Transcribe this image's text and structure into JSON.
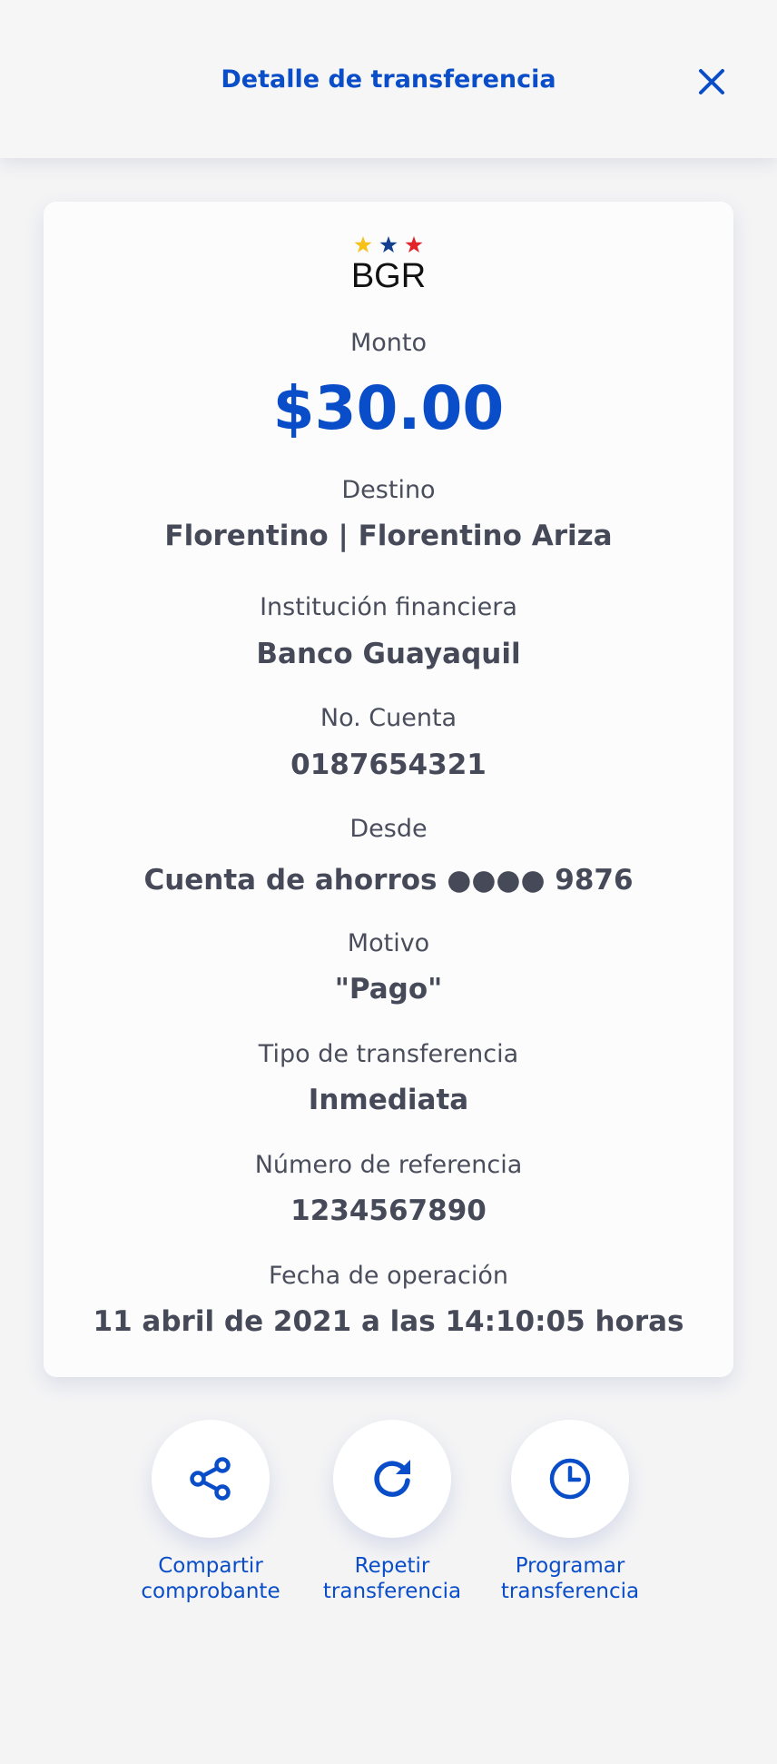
{
  "header": {
    "title": "Detalle de transferencia",
    "close_icon": "close-icon"
  },
  "card": {
    "logo_text": "BGR",
    "logo_star_colors": [
      "#f6c21a",
      "#143f8f",
      "#e2242b"
    ],
    "amount_label": "Monto",
    "amount": "$30.00",
    "fields": [
      {
        "label": "Destino",
        "value": "Florentino | Florentino Ariza"
      },
      {
        "label": "Institución financiera",
        "value": "Banco Guayaquil"
      },
      {
        "label": "No. Cuenta",
        "value": "0187654321"
      },
      {
        "label": "Desde",
        "value": "Cuenta de ahorros ●●●● 9876"
      },
      {
        "label": "Motivo",
        "value": "\"Pago\""
      },
      {
        "label": "Tipo de transferencia",
        "value": "Inmediata"
      },
      {
        "label": "Número de referencia",
        "value": "1234567890"
      },
      {
        "label": "Fecha de operación",
        "value": "11 abril de 2021 a las 14:10:05 horas"
      }
    ]
  },
  "actions": [
    {
      "icon": "share-icon",
      "line1": "Compartir",
      "line2": "comprobante"
    },
    {
      "icon": "repeat-icon",
      "line1": "Repetir",
      "line2": "transferencia"
    },
    {
      "icon": "clock-icon",
      "line1": "Programar",
      "line2": "transferencia"
    }
  ],
  "colors": {
    "accent": "#0a4dc8",
    "text": "#454958",
    "background": "#f4f4f5",
    "card": "#fcfcfd"
  }
}
